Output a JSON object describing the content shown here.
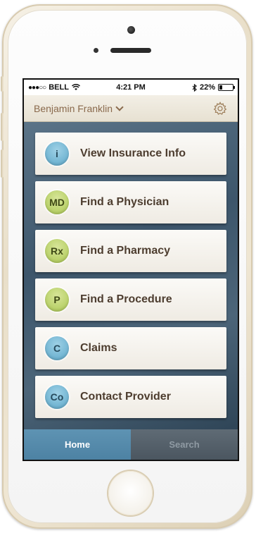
{
  "status_bar": {
    "carrier": "BELL",
    "time": "4:21 PM",
    "battery_text": "22%",
    "battery_level": 0.22
  },
  "header": {
    "user_name": "Benjamin Franklin",
    "settings_icon": "gear-icon"
  },
  "menu": [
    {
      "badge": "i",
      "label": "View Insurance Info",
      "color": "#5aa6c8"
    },
    {
      "badge": "MD",
      "label": "Find a Physician",
      "color": "#a9c650"
    },
    {
      "badge": "Rx",
      "label": "Find a Pharmacy",
      "color": "#a9c650"
    },
    {
      "badge": "P",
      "label": "Find a Procedure",
      "color": "#a9c650"
    },
    {
      "badge": "C",
      "label": "Claims",
      "color": "#5aa6c8"
    },
    {
      "badge": "Co",
      "label": "Contact Provider",
      "color": "#5aa6c8"
    }
  ],
  "tabs": [
    {
      "label": "Home",
      "active": true
    },
    {
      "label": "Search",
      "active": false
    }
  ],
  "colors": {
    "accent": "#5e93b3",
    "header_text": "#8a6a4d",
    "menu_text": "#4d3d2f"
  }
}
